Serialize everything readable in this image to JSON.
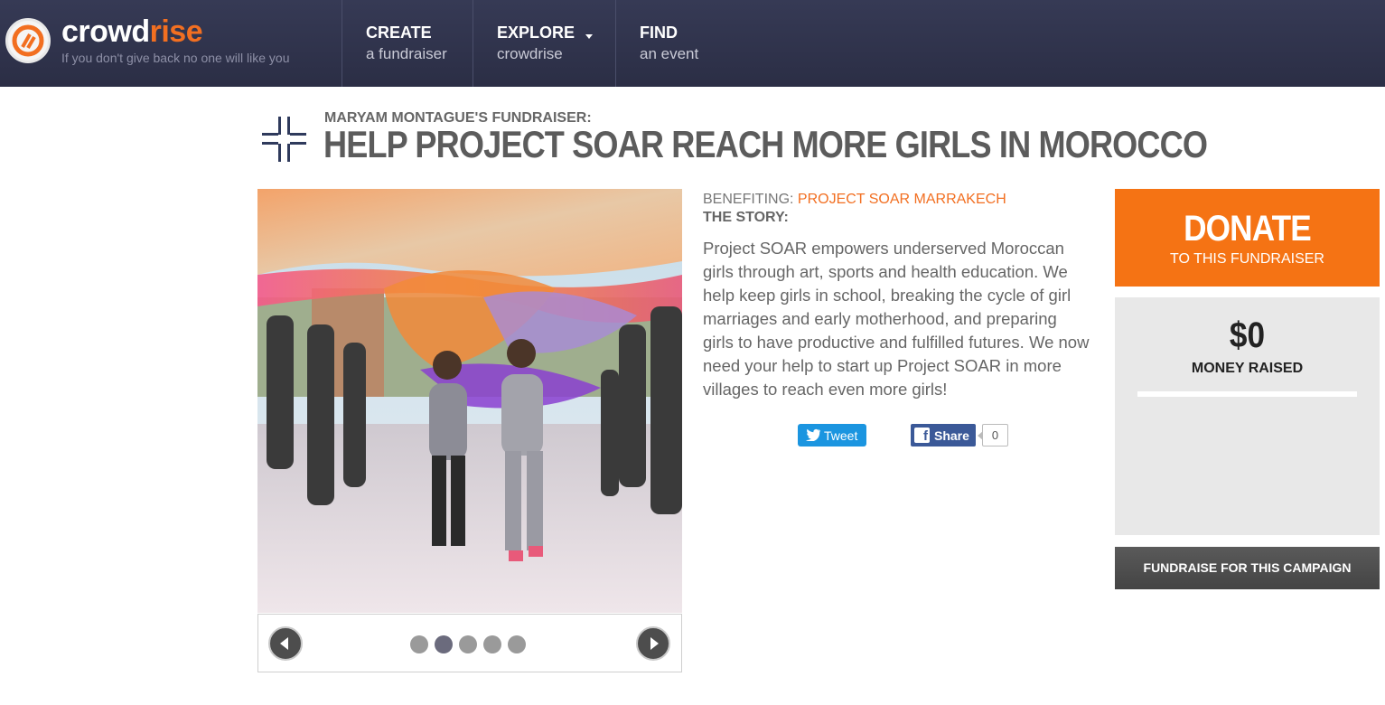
{
  "header": {
    "logo_text_part1": "crowd",
    "logo_text_part2": "rise",
    "tagline": "If you don't give back no one will like you",
    "nav": [
      {
        "title": "CREATE",
        "subtitle": "a fundraiser"
      },
      {
        "title": "EXPLORE",
        "subtitle": "crowdrise"
      },
      {
        "title": "FIND",
        "subtitle": "an event"
      }
    ]
  },
  "fundraiser": {
    "owner_label": "MARYAM MONTAGUE'S FUNDRAISER:",
    "title": "HELP PROJECT SOAR REACH MORE GIRLS IN MOROCCO",
    "benefiting_label": "BENEFITING:",
    "benefiting_org": "PROJECT SOAR MARRAKECH",
    "story_heading": "THE STORY:",
    "story": "Project SOAR empowers underserved Moroccan girls through art, sports and health education. We help keep girls in school, breaking the cycle of girl marriages and early motherhood, and preparing girls to have productive and fulfilled futures. We now need your help to start up Project SOAR in more villages to reach even more girls!"
  },
  "gallery": {
    "slide_count": 5,
    "active_slide": 2
  },
  "social": {
    "tweet_label": "Tweet",
    "share_label": "Share",
    "share_count": "0"
  },
  "sidebar": {
    "donate_label": "DONATE",
    "donate_sub": "TO THIS FUNDRAISER",
    "money_raised": "$0",
    "money_raised_label": "MONEY RAISED",
    "progress_fraction": 0,
    "fundraise_label": "FUNDRAISE FOR THIS CAMPAIGN"
  },
  "colors": {
    "accent_orange": "#f57314",
    "header_bg": "#2f3249",
    "twitter_blue": "#1b95e0",
    "facebook_blue": "#3b5998"
  }
}
